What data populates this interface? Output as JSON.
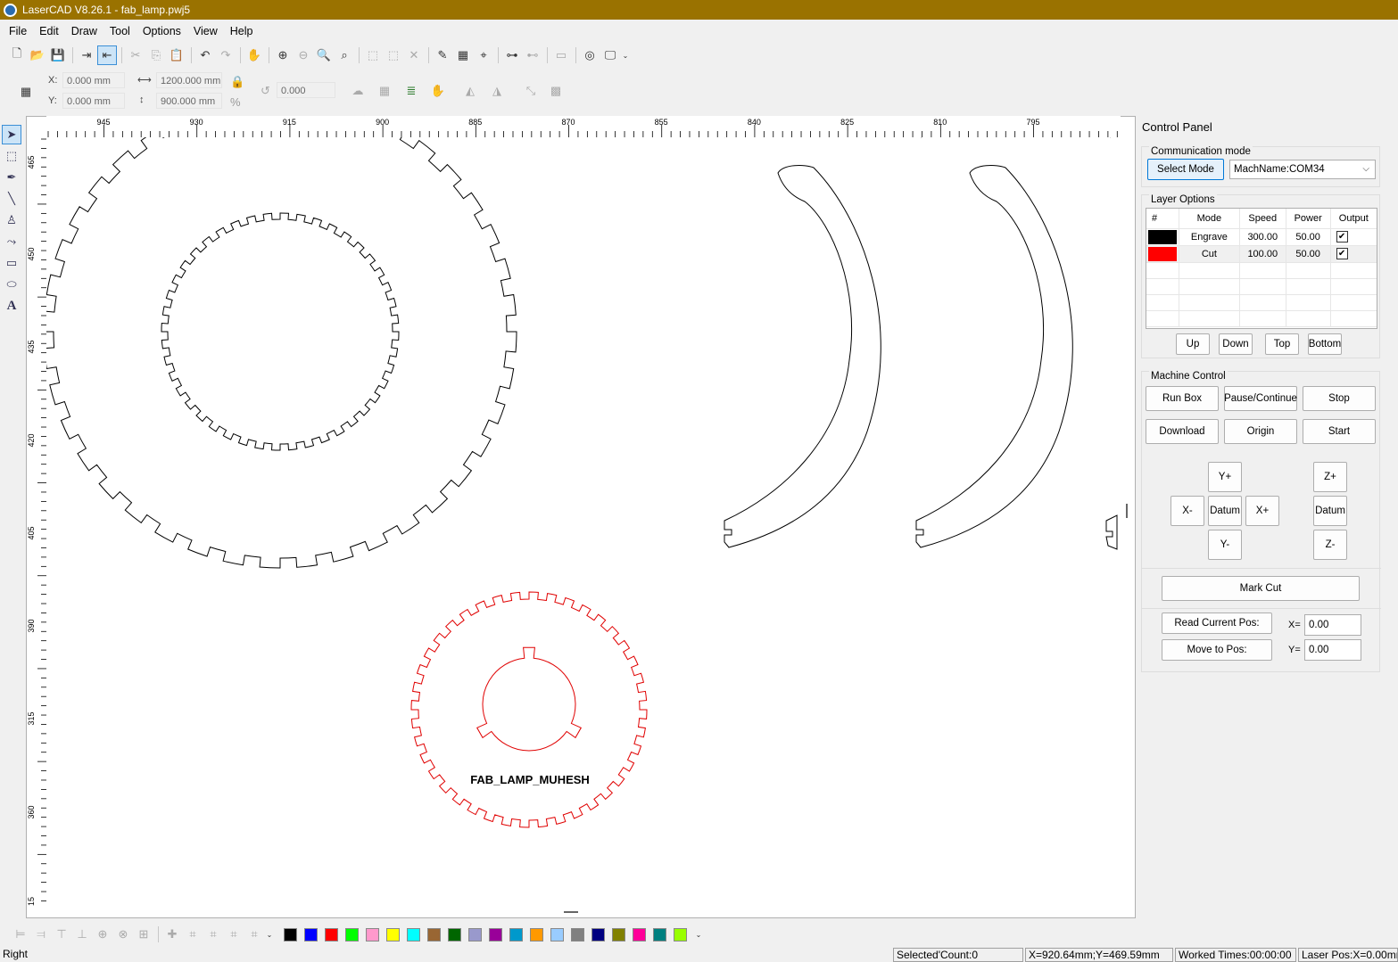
{
  "window": {
    "title": "LaserCAD V8.26.1 - fab_lamp.pwj5"
  },
  "menu": [
    "File",
    "Edit",
    "Draw",
    "Tool",
    "Options",
    "View",
    "Help"
  ],
  "coords": {
    "x_label": "X:",
    "x_value": "0.000 mm",
    "y_label": "Y:",
    "y_value": "0.000 mm",
    "width_value": "1200.000 mm",
    "height_value": "900.000 mm",
    "percent": "%",
    "rotate_value": "0.000"
  },
  "ruler": {
    "h_ticks": [
      "945",
      "930",
      "915",
      "900",
      "885",
      "870",
      "855",
      "840",
      "825",
      "810",
      "795"
    ],
    "v_ticks": [
      "465",
      "450",
      "435",
      "420",
      "405",
      "390",
      "315",
      "360",
      "15"
    ]
  },
  "canvas": {
    "engraved_text": "FAB_LAMP_MUHESH"
  },
  "palette": [
    "#000000",
    "#0000ff",
    "#ff0000",
    "#00ff00",
    "#ff99cc",
    "#ffff00",
    "#00ffff",
    "#996633",
    "#006600",
    "#9999cc",
    "#990099",
    "#0099cc",
    "#ff9900",
    "#99ccff",
    "#808080",
    "#000080",
    "#808000",
    "#ff0099",
    "#008080",
    "#99ff00"
  ],
  "control_panel": {
    "title": "Control Panel",
    "comm": {
      "label": "Communication mode",
      "select_mode": "Select Mode",
      "machine": "MachName:COM34"
    },
    "layer_options": {
      "label": "Layer Options",
      "headers": [
        "#",
        "Mode",
        "Speed",
        "Power",
        "Output"
      ],
      "rows": [
        {
          "color": "#000000",
          "mode": "Engrave",
          "speed": "300.00",
          "power": "50.00",
          "output": "✔"
        },
        {
          "color": "#ff0000",
          "mode": "Cut",
          "speed": "100.00",
          "power": "50.00",
          "output": "✔"
        }
      ],
      "buttons": [
        "Up",
        "Down",
        "Top",
        "Bottom"
      ]
    },
    "machine_control": {
      "label": "Machine Control",
      "run_box": "Run Box",
      "pause": "Pause/Continue",
      "stop": "Stop",
      "download": "Download",
      "origin": "Origin",
      "start": "Start",
      "y_plus": "Y+",
      "x_minus": "X-",
      "datum": "Datum",
      "x_plus": "X+",
      "y_minus": "Y-",
      "z_plus": "Z+",
      "z_datum": "Datum",
      "z_minus": "Z-",
      "mark_cut": "Mark Cut",
      "read_pos": "Read Current Pos:",
      "move_pos": "Move to Pos:",
      "x_label": "X=",
      "x_value": "0.00",
      "y_label": "Y=",
      "y_value": "0.00"
    }
  },
  "status": {
    "left": "Right",
    "selected": "Selected'Count:0",
    "xy": "X=920.64mm;Y=469.59mm",
    "worked": "Worked Times:00:00:00",
    "laser": "Laser Pos:X=0.00mm"
  }
}
